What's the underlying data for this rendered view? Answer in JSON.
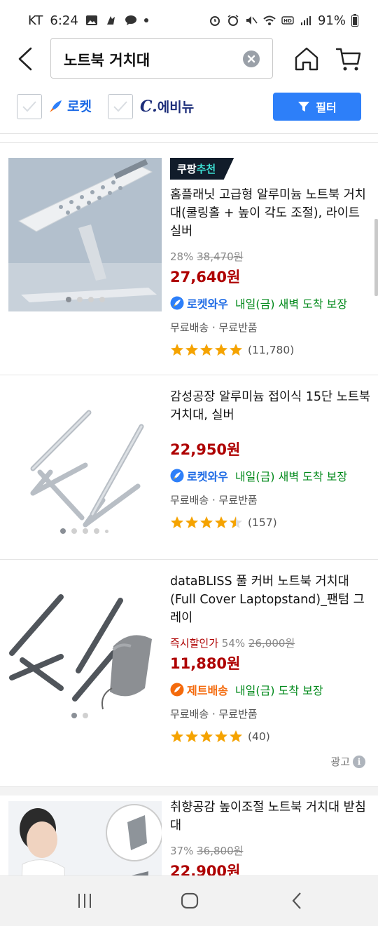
{
  "status": {
    "carrier": "KT",
    "time": "6:24",
    "battery": "91%"
  },
  "search": {
    "query": "노트북 거치대"
  },
  "filters": {
    "rocket_label": "로켓",
    "evenue_c": "C.",
    "evenue_label": "에비뉴",
    "filter_label": "필터"
  },
  "products": [
    {
      "badge_main": "쿠팡",
      "badge_accent": "추천",
      "name": "홈플래닛 고급형 알루미늄 노트북 거치대(쿨링홀 + 높이 각도 조절), 라이트 실버",
      "discount": "28%",
      "original_price": "38,470원",
      "price": "27,640원",
      "delivery_badge": "로켓와우",
      "delivery_text": "내일(금) 새벽 도착 보장",
      "shipping": "무료배송 · 무료반품",
      "rating": 5,
      "review_count": "(11,780)"
    },
    {
      "name": "감성공장 알루미늄 접이식 15단 노트북 거치대, 실버",
      "price": "22,950원",
      "delivery_badge": "로켓와우",
      "delivery_text": "내일(금) 새벽 도착 보장",
      "shipping": "무료배송 · 무료반품",
      "rating": 4.5,
      "review_count": "(157)"
    },
    {
      "name": "dataBLISS 풀 커버 노트북 거치대 (Full Cover Laptopstand)_팬텀 그레이",
      "instant_label": "즉시할인가",
      "discount": "54%",
      "original_price": "26,000원",
      "price": "11,880원",
      "delivery_badge": "제트배송",
      "delivery_text": "내일(금) 도착 보장",
      "shipping": "무료배송 · 무료반품",
      "rating": 5,
      "review_count": "(40)",
      "ad_label": "광고",
      "ad_info_glyph": "i"
    },
    {
      "name": "취향공감 높이조절 노트북 거치대 받침대",
      "discount": "37%",
      "original_price": "36,800원",
      "price": "22,900원"
    }
  ],
  "colors": {
    "accent_blue": "#2d7ff9",
    "price_red": "#ae0000",
    "delivery_green": "#00891a",
    "star": "#f5a300"
  }
}
